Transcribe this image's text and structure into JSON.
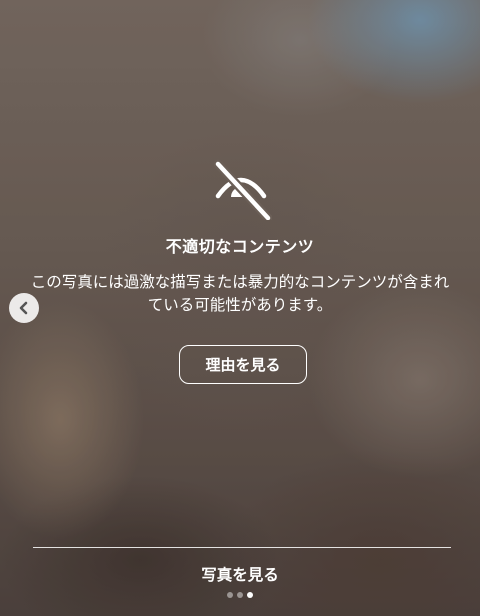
{
  "warning": {
    "icon": "eye-slash-icon",
    "title": "不適切なコンテンツ",
    "description": "この写真には過激な描写または暴力的なコンテンツが含まれている可能性があります。",
    "reason_button": "理由を見る"
  },
  "footer": {
    "view_photo": "写真を見る"
  },
  "pagination": {
    "total": 3,
    "current": 3
  },
  "navigation": {
    "previous_icon": "chevron-left-icon"
  }
}
